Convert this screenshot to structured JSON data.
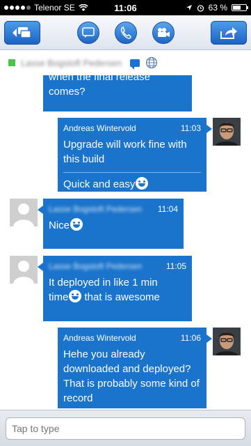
{
  "status": {
    "carrier": "Telenor SE",
    "time": "11:06",
    "battery": "63 %",
    "battery_level": 0.63
  },
  "toolbar": {
    "back_icon": "chat-list-icon",
    "chat_icon": "chat-bubble-icon",
    "call_icon": "phone-icon",
    "video_icon": "video-camera-icon",
    "share_icon": "share-icon"
  },
  "contact": {
    "name": "Lasse Bogstoft Pedersen",
    "presence_color": "#4cc24c"
  },
  "messages": [
    {
      "direction": "outgoing",
      "text": "when the final release comes?"
    },
    {
      "direction": "outgoing",
      "sender": "Andreas Wintervold",
      "time": "11:03",
      "text1": "Upgrade will work fine with this build",
      "text2": "Quick and easy"
    },
    {
      "direction": "incoming",
      "sender": "Lasse Bogstoft Pedersen",
      "time": "11:04",
      "text": "Nice"
    },
    {
      "direction": "incoming",
      "sender": "Lasse Bogstoft Pedersen",
      "time": "11:05",
      "text_a": "It deployed in like 1 min",
      "text_b": "time",
      "text_c": " that is awesome"
    },
    {
      "direction": "outgoing",
      "sender": "Andreas Wintervold",
      "time": "11:06",
      "text": "Hehe you already downloaded and deployed? That is probably some kind of record"
    }
  ],
  "input": {
    "placeholder": "Tap to type"
  },
  "colors": {
    "bubble": "#1a74cb",
    "accent": "#1d66c5"
  }
}
